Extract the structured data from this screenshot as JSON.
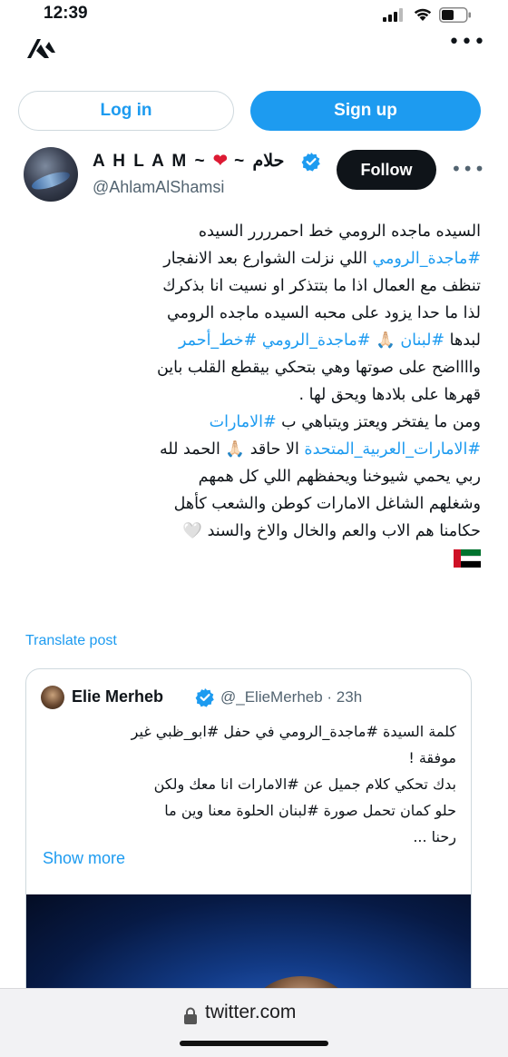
{
  "status_bar": {
    "time": "12:39",
    "icons": [
      "cellular-signal-icon",
      "wifi-icon",
      "battery-icon"
    ]
  },
  "top_bar": {
    "logo": "app-logo-icon",
    "more": "•••"
  },
  "auth": {
    "login_label": "Log in",
    "signup_label": "Sign up"
  },
  "post": {
    "author_name": "A H L A M ~ ",
    "heart": "❤",
    "author_name_ar": " ~ حلام",
    "handle": "@AhlamAlShamsi",
    "follow_label": "Follow",
    "more": "•••",
    "lines": [
      {
        "segments": [
          {
            "text": "السيده ماجده الرومي خط احمرررر السيده",
            "link": false
          }
        ]
      },
      {
        "segments": [
          {
            "text": "#ماجدة_الرومي",
            "link": true
          },
          {
            "text": "  اللي نزلت الشوارع بعد الانفجار",
            "link": false
          }
        ]
      },
      {
        "segments": [
          {
            "text": "تنظف مع العمال اذا ما بتتذكر او نسيت انا بذكرك",
            "link": false
          }
        ]
      },
      {
        "segments": [
          {
            "text": "لذا ما حدا يزود على محبه السيده ماجده الرومي",
            "link": false
          }
        ]
      },
      {
        "segments": [
          {
            "text": "لبدها ",
            "link": false
          },
          {
            "text": "#لبنان",
            "link": true
          },
          {
            "text": " 🙏🏻 ",
            "link": false
          },
          {
            "text": "#ماجدة_الرومي #خط_أحمر",
            "link": true
          }
        ]
      },
      {
        "segments": [
          {
            "text": "وااااضح على صوتها وهي بتحكي بيقطع القلب باين",
            "link": false
          }
        ]
      },
      {
        "segments": [
          {
            "text": "قهرها على بلادها  ويحق لها .",
            "link": false
          }
        ]
      },
      {
        "segments": [
          {
            "text": "ومن ما يفتخر ويعتز ويتباهي ب ",
            "link": false
          },
          {
            "text": "#الامارات",
            "link": true
          }
        ]
      },
      {
        "segments": [
          {
            "text": "#الامارات_العربية_المتحدة",
            "link": true
          },
          {
            "text": "  الا حاقد 🙏🏻 الحمد لله",
            "link": false
          }
        ]
      },
      {
        "segments": [
          {
            "text": "ربي يحمي شيوخنا ويحفظهم اللي كل همهم",
            "link": false
          }
        ]
      },
      {
        "segments": [
          {
            "text": "وشغلهم الشاغل الامارات كوطن والشعب كأهل",
            "link": false
          }
        ]
      },
      {
        "segments": [
          {
            "text": "حكامنا هم الاب والعم والخال والاخ والسند 🤍",
            "link": false
          }
        ]
      }
    ],
    "flag": "uae-flag-icon",
    "translate_label": "Translate post"
  },
  "quoted": {
    "author_name": "Elie Merheb",
    "handle_time": "@_ElieMerheb · 23h",
    "lines": [
      {
        "segments": [
          {
            "text": "كلمة السيدة #ماجدة_الرومي في حفل #ابو_ظبي غير",
            "link": false
          }
        ]
      },
      {
        "segments": [
          {
            "text": "موفقة !",
            "link": false
          }
        ]
      },
      {
        "segments": [
          {
            "text": "بدك تحكي كلام جميل عن #الامارات انا معك ولكن",
            "link": false
          }
        ]
      },
      {
        "segments": [
          {
            "text": "حلو كمان تحمل صورة #لبنان الحلوة معنا وين ما",
            "link": false
          }
        ]
      },
      {
        "segments": [
          {
            "text": "رحنا ...",
            "link": false
          }
        ]
      }
    ],
    "show_more_label": "Show more"
  },
  "url_bar": {
    "url": "twitter.com"
  },
  "colors": {
    "accent": "#1d9bf0",
    "text": "#0f1419",
    "muted": "#536471",
    "border": "#cfd9de"
  }
}
